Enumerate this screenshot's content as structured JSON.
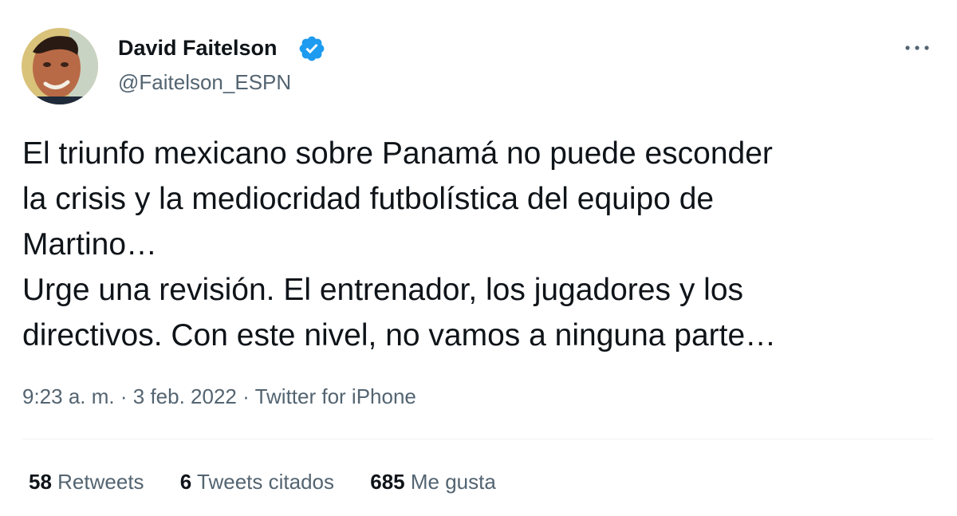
{
  "author": {
    "display_name": "David Faitelson",
    "handle": "@Faitelson_ESPN",
    "verified": true,
    "avatar_icon": "profile-photo"
  },
  "more_icon": "more-horizontal-icon",
  "tweet": {
    "lines": [
      "El triunfo mexicano sobre Panamá no puede esconder",
      "la crisis y la mediocridad futbolística del equipo de",
      "Martino…",
      "Urge una revisión. El entrenador, los jugadores y los",
      "directivos. Con este nivel, no vamos a ninguna parte…"
    ]
  },
  "meta": {
    "time": "9:23 a. m.",
    "separator": "·",
    "date": "3 feb. 2022",
    "source": "Twitter for iPhone"
  },
  "stats": {
    "retweets_count": "58",
    "retweets_label": "Retweets",
    "quotes_count": "6",
    "quotes_label": "Tweets citados",
    "likes_count": "685",
    "likes_label": "Me gusta"
  },
  "colors": {
    "text_primary": "#0f1419",
    "text_secondary": "#536471",
    "verified_blue": "#1d9bf0",
    "divider": "#eff3f4"
  }
}
